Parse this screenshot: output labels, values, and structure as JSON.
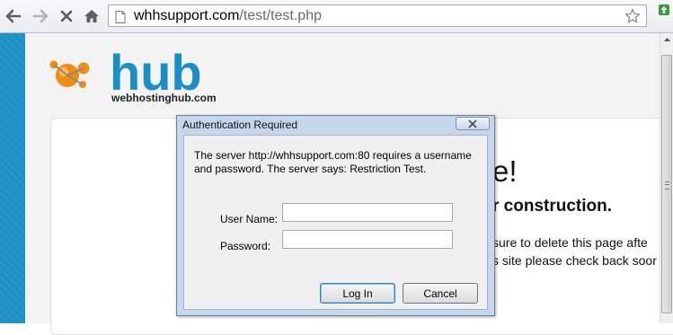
{
  "browser": {
    "url_domain": "whhsupport.com",
    "url_path": "/test/test.php",
    "icons": [
      "back-arrow-icon",
      "forward-arrow-icon",
      "stop-icon",
      "home-icon",
      "page-icon",
      "bookmark-star-icon",
      "extension-icon"
    ]
  },
  "page": {
    "logo_text": "hub",
    "logo_subtext": "webhostinghub.com",
    "welcome_fragment": "e!",
    "construction_fragment": "r construction.",
    "line1_fragment": "sure to delete this page afte",
    "line2_fragment": "s site please check back soor"
  },
  "dialog": {
    "title": "Authentication Required",
    "message": "The server http://whhsupport.com:80 requires a username and password. The server says: Restriction Test.",
    "username_label": "User Name:",
    "username_value": "",
    "password_label": "Password:",
    "password_value": "",
    "login_label": "Log In",
    "cancel_label": "Cancel"
  },
  "colors": {
    "sidebar_blue": "#1d90c5",
    "logo_blue": "#1a8fc4",
    "logo_orange": "#f28c12",
    "dialog_frame": "#c5d7ec"
  }
}
